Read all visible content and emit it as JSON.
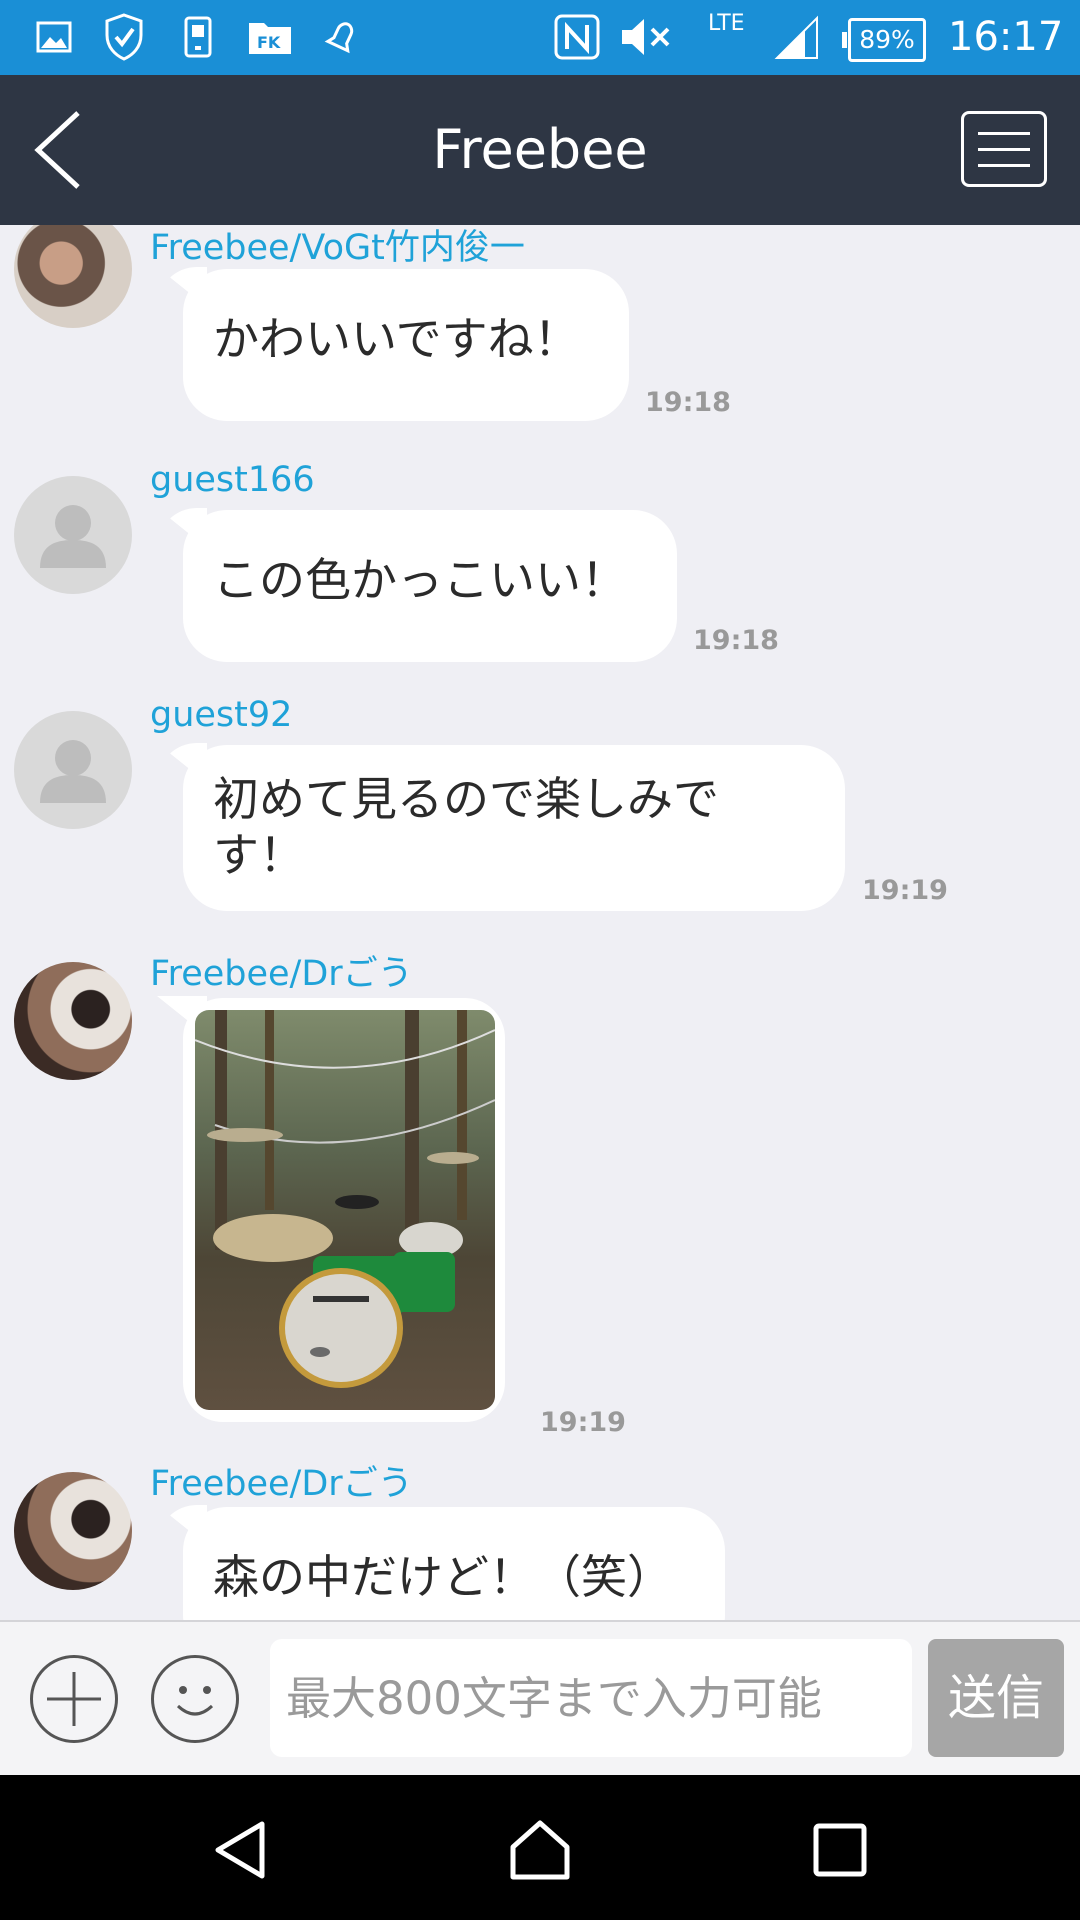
{
  "status_bar": {
    "battery": "89%",
    "network": "LTE",
    "time": "16:17",
    "left_icons": [
      "gallery-icon",
      "shield-icon",
      "sim-icon",
      "fk-app-icon",
      "bell-icon"
    ],
    "right_icons": [
      "nfc-icon",
      "mute-icon",
      "signal-icon",
      "battery-icon"
    ]
  },
  "header": {
    "title": "Freebee"
  },
  "messages": [
    {
      "user": "Freebee/VoGt竹内俊一",
      "text": "かわいいですね！",
      "time": "19:18"
    },
    {
      "user": "guest166",
      "text": "この色かっこいい！",
      "time": "19:18"
    },
    {
      "user": "guest92",
      "text": "初めて見るので楽しみです！",
      "time": "19:19"
    },
    {
      "user": "Freebee/Drごう",
      "time": "19:19"
    },
    {
      "user": "Freebee/Drごう",
      "text": "森の中だけど！（笑）"
    }
  ],
  "input": {
    "placeholder": "最大800文字まで入力可能",
    "send_label": "送信"
  },
  "colors": {
    "status_bar": "#1a8fd6",
    "header": "#2e3644",
    "username": "#1fa2d8",
    "chat_bg": "#efeff4",
    "send_button": "#a6a6a6"
  }
}
